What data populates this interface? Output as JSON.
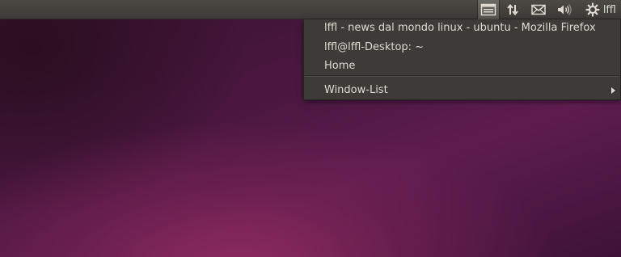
{
  "panel": {
    "username": "lffl",
    "indicators": [
      "window-list-icon",
      "network-arrows-icon",
      "envelope-icon",
      "volume-icon",
      "gear-icon"
    ],
    "colors": {
      "panel_bg": "#3c3b37",
      "text": "#dfdbd2",
      "menu_bg": "#3c3b37"
    }
  },
  "menu": {
    "items": [
      {
        "label": "lffl - news dal mondo linux - ubuntu - Mozilla Firefox"
      },
      {
        "label": "lffl@lffl-Desktop: ~"
      },
      {
        "label": "Home"
      },
      {
        "label": "Window-List"
      }
    ]
  }
}
